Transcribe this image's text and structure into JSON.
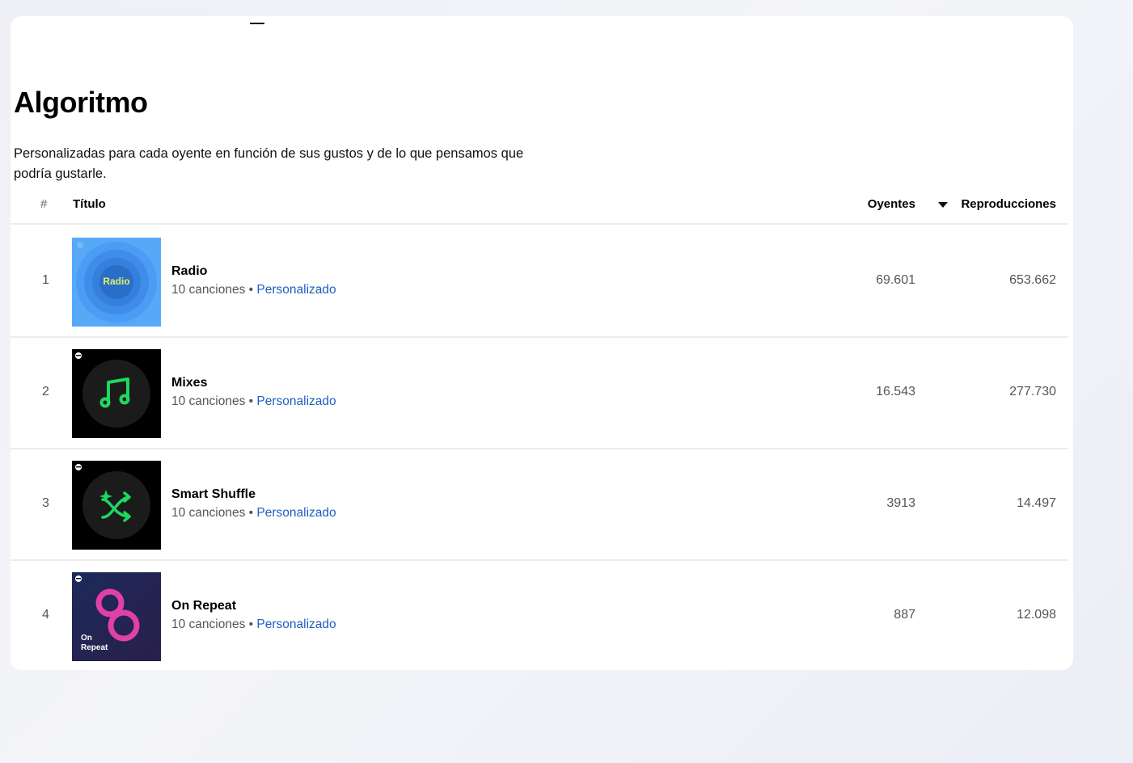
{
  "section": {
    "title": "Algoritmo",
    "description": "Personalizadas para cada oyente en función de sus gustos y de lo que pensamos que podría gustarle."
  },
  "table": {
    "headers": {
      "number": "#",
      "title": "Título",
      "listeners": "Oyentes",
      "plays": "Reproducciones"
    },
    "sort": {
      "column": "plays",
      "direction": "descending",
      "icon": "caret-down-icon"
    },
    "rows": [
      {
        "num": "1",
        "name": "Radio",
        "songs": "10 canciones",
        "sep": "•",
        "type": "Personalizado",
        "listeners": "69.601",
        "plays": "653.662",
        "cover_text": "Radio",
        "cover_icon": "radio-cover"
      },
      {
        "num": "2",
        "name": "Mixes",
        "songs": "10 canciones",
        "sep": "•",
        "type": "Personalizado",
        "listeners": "16.543",
        "plays": "277.730",
        "cover_icon": "music-note-icon"
      },
      {
        "num": "3",
        "name": "Smart Shuffle",
        "songs": "10 canciones",
        "sep": "•",
        "type": "Personalizado",
        "listeners": "3913",
        "plays": "14.497",
        "cover_icon": "smart-shuffle-icon"
      },
      {
        "num": "4",
        "name": "On Repeat",
        "songs": "10 canciones",
        "sep": "•",
        "type": "Personalizado",
        "listeners": "887",
        "plays": "12.098",
        "cover_text": "On Repeat",
        "cover_icon": "on-repeat-cover"
      }
    ]
  },
  "colors": {
    "link": "#1e5fbf",
    "spotify_green": "#1ed760",
    "radio_blue": "#3d8ff0",
    "on_repeat_pink": "#e040a8"
  }
}
